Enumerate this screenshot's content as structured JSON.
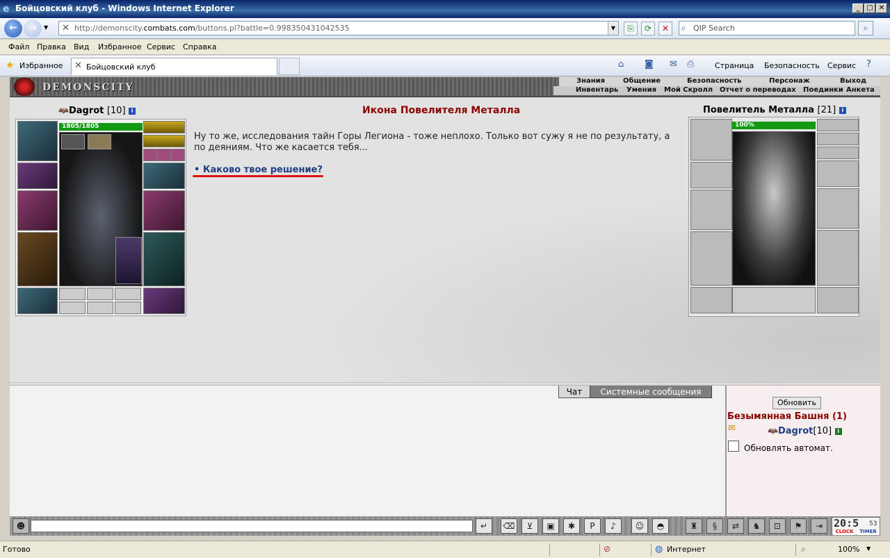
{
  "window": {
    "title": "Бойцовский клуб - Windows Internet Explorer",
    "minimize": "_",
    "maximize": "□",
    "close": "✕"
  },
  "address": {
    "url_prefix": "http://demonscity.",
    "url_domain": "combats.com",
    "url_suffix": "/buttons.pl?battle=0.998350431042535",
    "search_placeholder": "QIP Search"
  },
  "menu": [
    "Файл",
    "Правка",
    "Вид",
    "Избранное",
    "Сервис",
    "Справка"
  ],
  "favorites": {
    "label": "Избранное",
    "tab_title": "Бойцовский клуб"
  },
  "command_bar": {
    "page": "Страница",
    "safety": "Безопасность",
    "tools": "Сервис"
  },
  "game": {
    "logo": "DEMONSCITY",
    "top_nav": [
      "Знания",
      "Общение",
      "Безопасность",
      "Персонаж",
      "Выход"
    ],
    "sub_nav": [
      "Инвентарь",
      "Умения",
      "Мой Скролл",
      "Отчет о переводах",
      "Поединки",
      "Анкета"
    ],
    "player": {
      "name": "Dagrot",
      "level": "[10]",
      "hp": "1805/1805",
      "hp_fraction": 1.0
    },
    "npc": {
      "name": "Повелитель Металла",
      "level": "[21]",
      "hp": "100%",
      "hp_fraction": 1.0
    },
    "dialog": {
      "title": "Икона Повелителя Металла",
      "text": "Ну то же, исследования тайн Горы Легиона - тоже неплохо. Только вот сужу я не по результату, а по деяниям. Что же касается тебя...",
      "answer": "Каково твое решение?"
    }
  },
  "chat": {
    "tab_chat": "Чат",
    "tab_system": "Системные сообщения",
    "refresh": "Обновить",
    "room": "Безымянная Башня (1)",
    "member_name": "Dagrot",
    "member_level": "[10]",
    "auto_refresh": "Обновлять автомат."
  },
  "clock": {
    "time": "20:5",
    "seconds": "53",
    "clock_label": "CLOCK",
    "timer_label": "TIMER"
  },
  "status": {
    "ready": "Готово",
    "zone": "Интернет",
    "zoom": "100%"
  },
  "colors": {
    "dialog_title": "#8b0000",
    "link": "#1f3e84",
    "hp_bar": "#129b12",
    "highlight_underline": "#dd1111"
  }
}
